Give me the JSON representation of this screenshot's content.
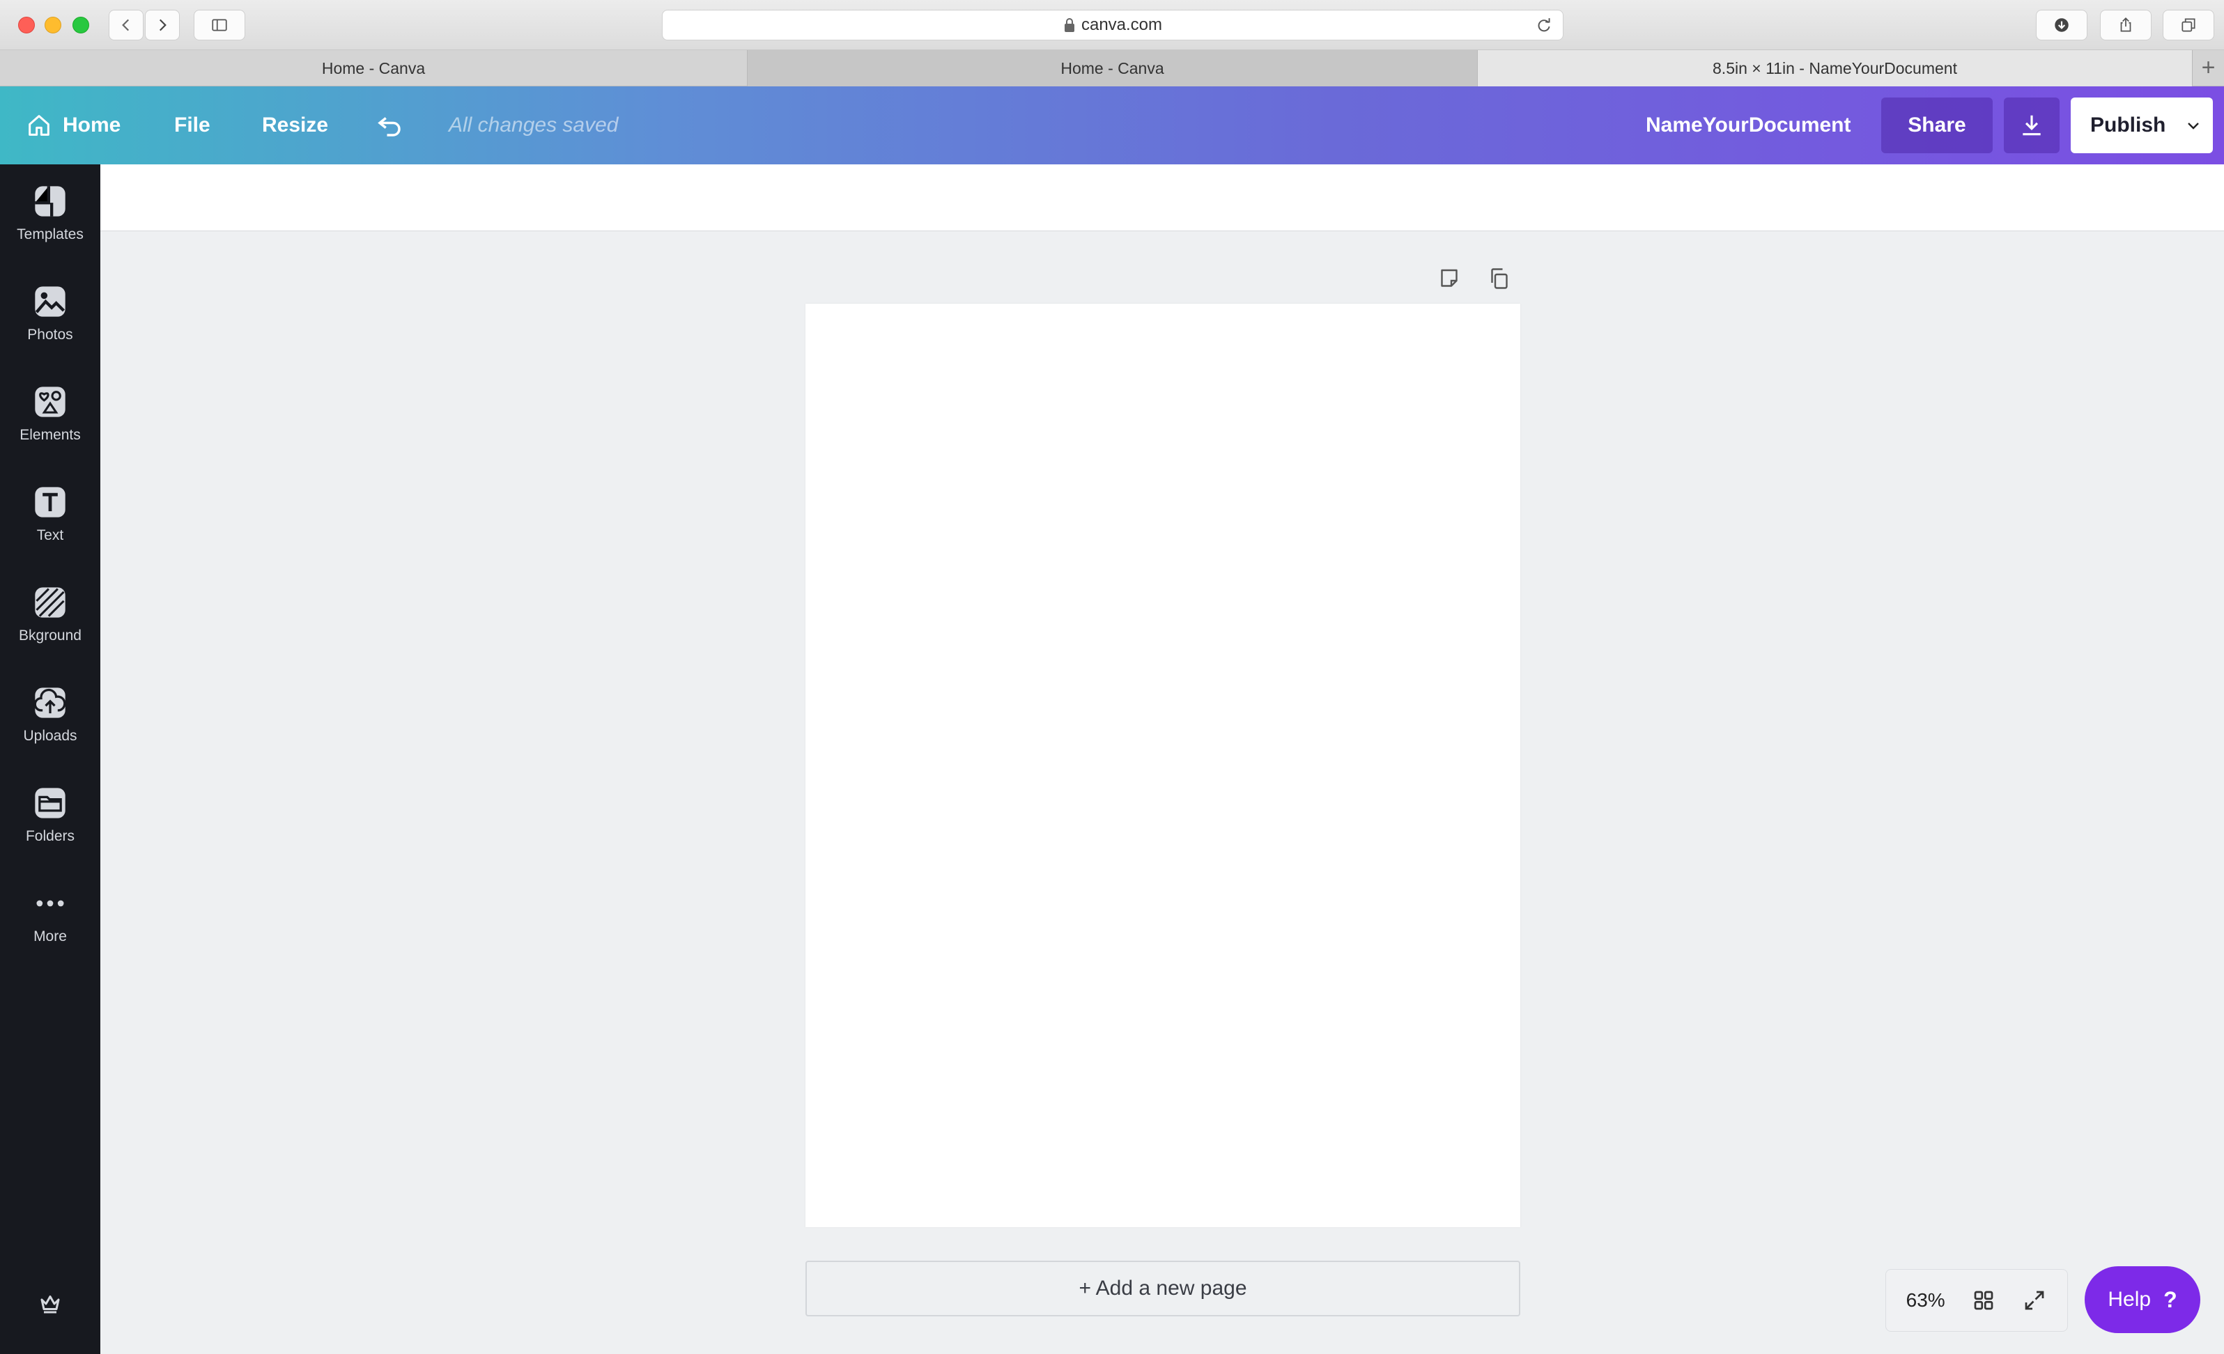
{
  "browser": {
    "url": "canva.com",
    "tabs": [
      {
        "label": "Home - Canva"
      },
      {
        "label": "Home - Canva"
      },
      {
        "label": "8.5in × 11in - NameYourDocument"
      }
    ],
    "new_tab_label": "+"
  },
  "header": {
    "home_label": "Home",
    "file_label": "File",
    "resize_label": "Resize",
    "save_status": "All changes saved",
    "doc_name": "NameYourDocument",
    "share_label": "Share",
    "publish_label": "Publish"
  },
  "sidebar": {
    "items": [
      {
        "label": "Templates",
        "icon": "templates-icon"
      },
      {
        "label": "Photos",
        "icon": "photos-icon"
      },
      {
        "label": "Elements",
        "icon": "elements-icon"
      },
      {
        "label": "Text",
        "icon": "text-icon"
      },
      {
        "label": "Bkground",
        "icon": "background-icon"
      },
      {
        "label": "Uploads",
        "icon": "uploads-icon"
      },
      {
        "label": "Folders",
        "icon": "folders-icon"
      },
      {
        "label": "More",
        "icon": "more-icon"
      }
    ]
  },
  "canvas": {
    "add_page_label": "+ Add a new page"
  },
  "footer": {
    "zoom": "63%",
    "help_label": "Help",
    "help_glyph": "?"
  },
  "colors": {
    "header_start": "#3fb8c6",
    "header_end": "#7b4ee3",
    "sidebar_bg": "#17191f",
    "help_button": "#7d2ae8"
  }
}
